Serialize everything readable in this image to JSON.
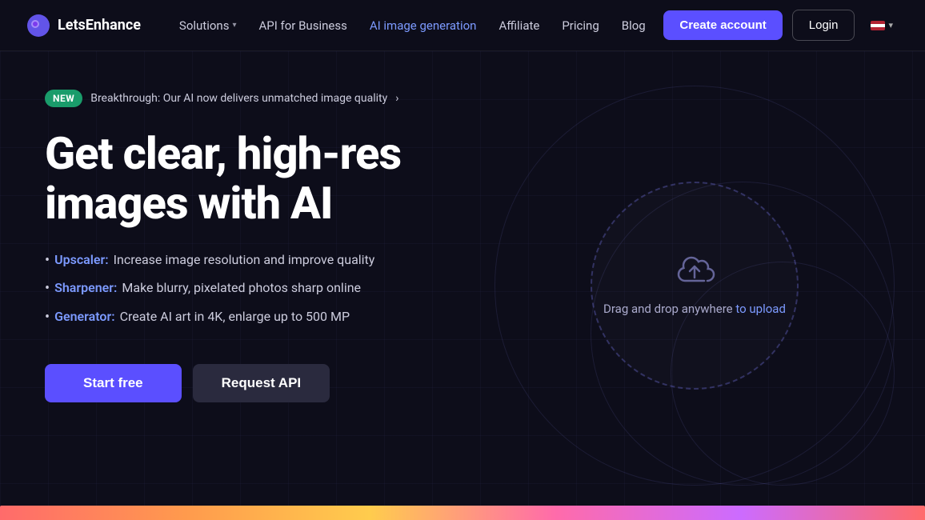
{
  "nav": {
    "logo_text": "LetsEnhance",
    "links": [
      {
        "label": "Solutions",
        "has_dropdown": true,
        "active": false
      },
      {
        "label": "API for Business",
        "has_dropdown": false,
        "active": false
      },
      {
        "label": "AI image generation",
        "has_dropdown": false,
        "active": true
      },
      {
        "label": "Affiliate",
        "has_dropdown": false,
        "active": false
      },
      {
        "label": "Pricing",
        "has_dropdown": false,
        "active": false
      },
      {
        "label": "Blog",
        "has_dropdown": false,
        "active": false
      }
    ],
    "create_account": "Create account",
    "login": "Login"
  },
  "hero": {
    "badge": "NEW",
    "badge_text": "Breakthrough: Our AI now delivers unmatched image quality",
    "title": "Get clear, high-res images with AI",
    "bullets": [
      {
        "feature": "Upscaler:",
        "text": " Increase image resolution and improve quality"
      },
      {
        "feature": "Sharpener:",
        "text": " Make blurry, pixelated photos sharp online"
      },
      {
        "feature": "Generator:",
        "text": " Create AI art in 4K, enlarge up to 500 MP"
      }
    ],
    "cta_start": "Start free",
    "cta_api": "Request API",
    "upload_text": "Drag and drop anywhere",
    "upload_link": "to upload"
  },
  "colors": {
    "accent": "#5b4fff",
    "feature_link": "#7c9aff",
    "badge_bg": "#1a9c6b",
    "upload_link": "#7c9aff"
  }
}
